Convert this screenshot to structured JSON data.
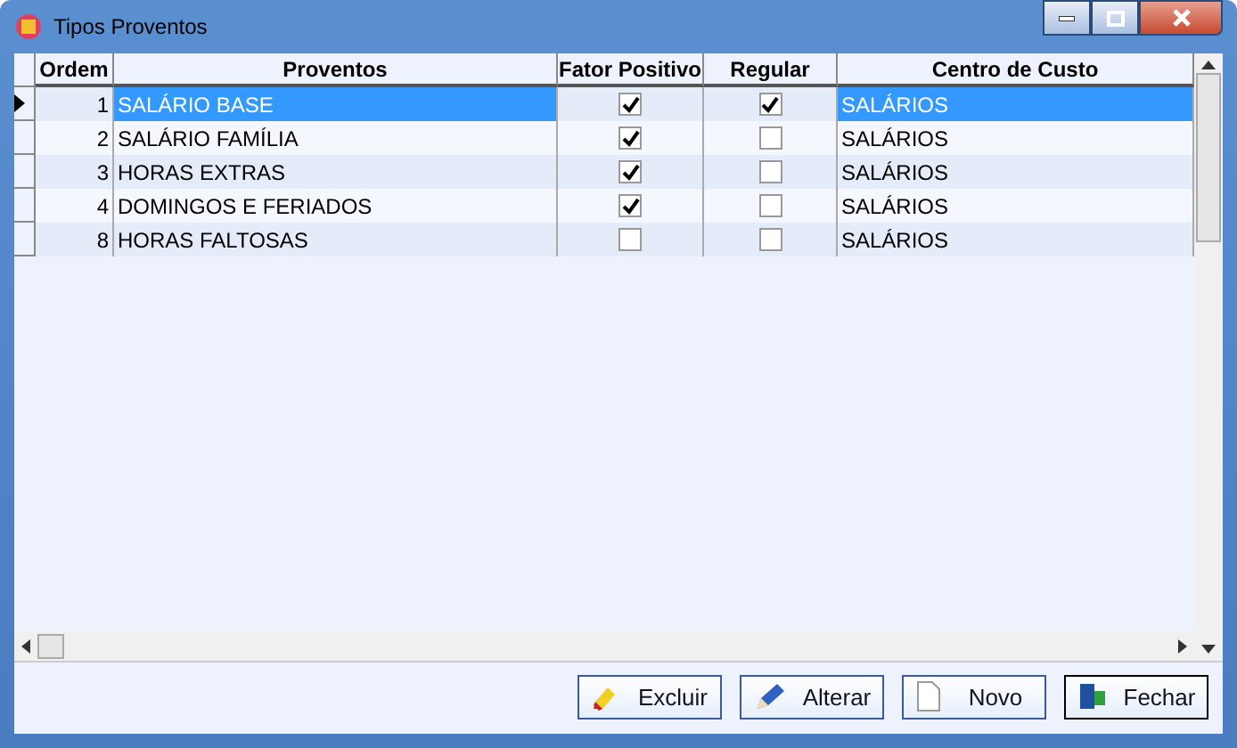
{
  "window": {
    "title": "Tipos Proventos"
  },
  "table": {
    "columns": [
      "Ordem",
      "Proventos",
      "Fator Positivo",
      "Regular",
      "Centro de Custo"
    ],
    "rows": [
      {
        "ordem": "1",
        "provento": "SALÁRIO BASE",
        "fator_positivo": true,
        "regular": true,
        "centro": "SALÁRIOS",
        "selected": true
      },
      {
        "ordem": "2",
        "provento": "SALÁRIO FAMÍLIA",
        "fator_positivo": true,
        "regular": false,
        "centro": "SALÁRIOS",
        "selected": false
      },
      {
        "ordem": "3",
        "provento": "HORAS EXTRAS",
        "fator_positivo": true,
        "regular": false,
        "centro": "SALÁRIOS",
        "selected": false
      },
      {
        "ordem": "4",
        "provento": "DOMINGOS E FERIADOS",
        "fator_positivo": true,
        "regular": false,
        "centro": "SALÁRIOS",
        "selected": false
      },
      {
        "ordem": "8",
        "provento": "HORAS FALTOSAS",
        "fator_positivo": false,
        "regular": false,
        "centro": "SALÁRIOS",
        "selected": false
      }
    ]
  },
  "buttons": [
    {
      "label": "Excluir",
      "kind": "delete"
    },
    {
      "label": "Alterar",
      "kind": "edit"
    },
    {
      "label": "Novo",
      "kind": "new"
    },
    {
      "label": "Fechar",
      "kind": "close"
    }
  ]
}
